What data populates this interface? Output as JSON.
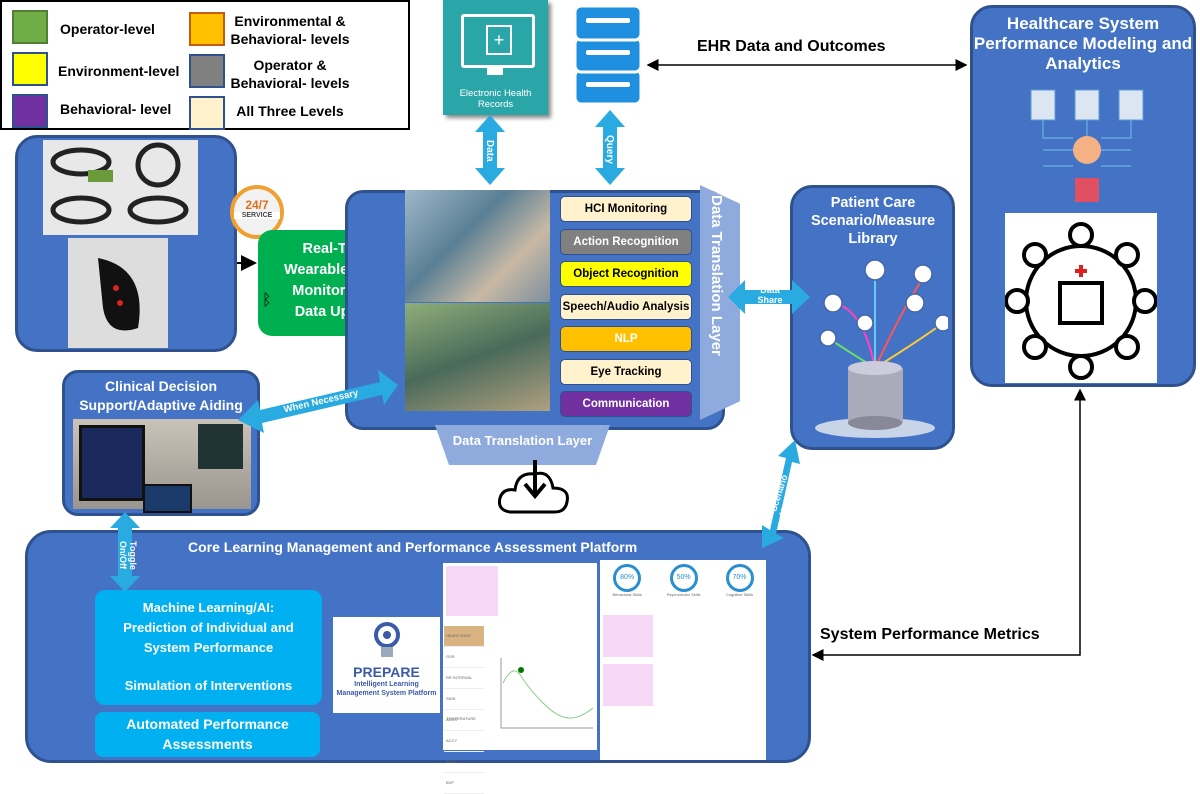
{
  "legend": [
    {
      "label": "Operator-level",
      "color": "#70ad47"
    },
    {
      "label": "Environment-level",
      "color": "#ffff00"
    },
    {
      "label": "Behavioral- level",
      "color": "#7030a0"
    },
    {
      "label": "Environmental & Behavioral- levels",
      "color": "#ffc000"
    },
    {
      "label": "Operator & Behavioral- levels",
      "color": "#808080"
    },
    {
      "label": "All Three Levels",
      "color": "#fff2cc"
    }
  ],
  "ehr": {
    "label": "Electronic Health Records"
  },
  "ehr_link": "EHR Data and Outcomes",
  "analytics": {
    "title": "Healthcare System Performance Modeling and Analytics"
  },
  "service_badge": {
    "top": "24/7",
    "bottom": "SERVICE"
  },
  "wearable": {
    "title": "Real-Time Wearable/Sensor Monitoring & Data Upload"
  },
  "modules": [
    {
      "label": "HCI Monitoring",
      "color": "#fff2cc",
      "text": "#000"
    },
    {
      "label": "Action Recognition",
      "color": "#808080",
      "text": "#fff"
    },
    {
      "label": "Object Recognition",
      "color": "#ffff00",
      "text": "#000"
    },
    {
      "label": "Speech/Audio Analysis",
      "color": "#fff2cc",
      "text": "#000"
    },
    {
      "label": "NLP",
      "color": "#ffc000",
      "text": "#fff"
    },
    {
      "label": "Eye Tracking",
      "color": "#fff2cc",
      "text": "#000"
    },
    {
      "label": "Communication",
      "color": "#7030a0",
      "text": "#fff"
    }
  ],
  "translation_layer_vertical": "Data Translation Layer",
  "translation_layer_bottom": "Data Translation Layer",
  "patient_care": {
    "title": "Patient Care Scenario/Measure Library"
  },
  "clinical": {
    "title": "Clinical Decision Support/Adaptive Aiding"
  },
  "arrows": {
    "data": "Data",
    "query": "Query",
    "data_share": "Data Share",
    "when_necessary": "When Necessary",
    "load_scenario": "Load Scenario Measures",
    "toggle": "Toggle On/Off",
    "system_metrics": "System Performance Metrics"
  },
  "platform": {
    "title": "Core Learning Management and Performance Assessment  Platform",
    "ml": {
      "line1": "Machine Learning/AI:",
      "line2": "Prediction of Individual and System Performance",
      "line3": "Simulation of Interventions"
    },
    "automated": "Automated Performance Assessments",
    "prepare": {
      "name": "PREPARE",
      "subtitle": "Intelligent Learning Management System Platform"
    },
    "gauges": [
      {
        "value": "80%",
        "label": "Behavioral Skills"
      },
      {
        "value": "50%",
        "label": "Psychomotor Skills"
      },
      {
        "value": "70%",
        "label": "Cognitive Skills"
      }
    ],
    "vitals": [
      "HEART RATE",
      "GSR",
      "RR INTERVAL",
      "SKIN TEMPERATURE",
      "ACCX",
      "ACCY",
      "ACCZ",
      "BVP"
    ]
  }
}
